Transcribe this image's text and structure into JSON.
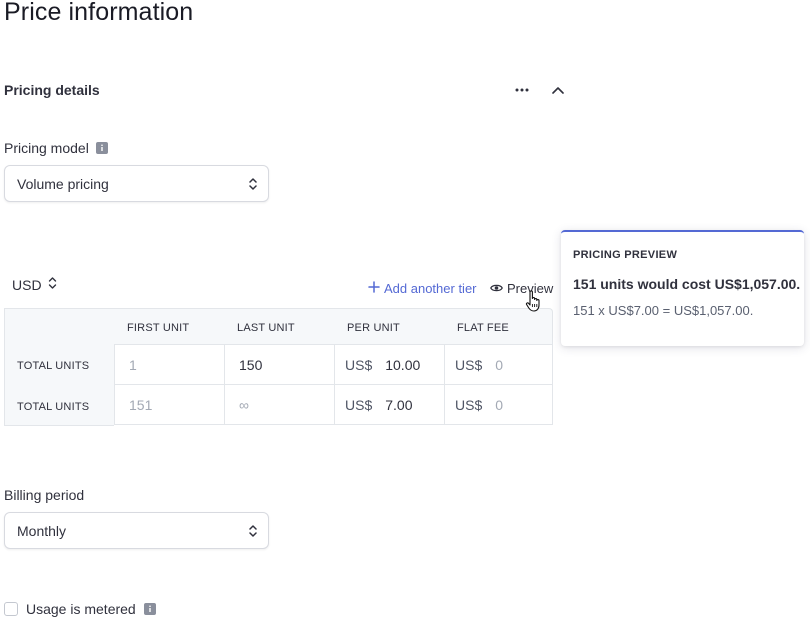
{
  "page": {
    "title": "Price information"
  },
  "pricing_details": {
    "title": "Pricing details",
    "more_icon": "more-horizontal-icon",
    "collapse_icon": "chevron-up-icon"
  },
  "pricing_model": {
    "label": "Pricing model",
    "value": "Volume pricing"
  },
  "currency": {
    "value": "USD"
  },
  "actions": {
    "add_tier": "Add another tier",
    "preview": "Preview"
  },
  "tiers": {
    "columns": [
      "FIRST UNIT",
      "LAST UNIT",
      "PER UNIT",
      "FLAT FEE"
    ],
    "rows": [
      {
        "label": "TOTAL UNITS",
        "first_unit": "1",
        "last_unit": "150",
        "per_unit_prefix": "US$",
        "per_unit": "10.00",
        "flat_fee_prefix": "US$",
        "flat_fee": "0"
      },
      {
        "label": "TOTAL UNITS",
        "first_unit": "151",
        "last_unit": "∞",
        "per_unit_prefix": "US$",
        "per_unit": "7.00",
        "flat_fee_prefix": "US$",
        "flat_fee": "0"
      }
    ]
  },
  "preview_popover": {
    "title": "PRICING PREVIEW",
    "summary": "151 units would cost US$1,057.00.",
    "formula": "151 x US$7.00 = US$1,057.00."
  },
  "billing_period": {
    "label": "Billing period",
    "value": "Monthly"
  },
  "usage": {
    "label": "Usage is metered",
    "checked": false
  },
  "colors": {
    "accent": "#5469d4",
    "text": "#30313d",
    "muted": "#a3a9b4",
    "border": "#e3e6ea"
  }
}
